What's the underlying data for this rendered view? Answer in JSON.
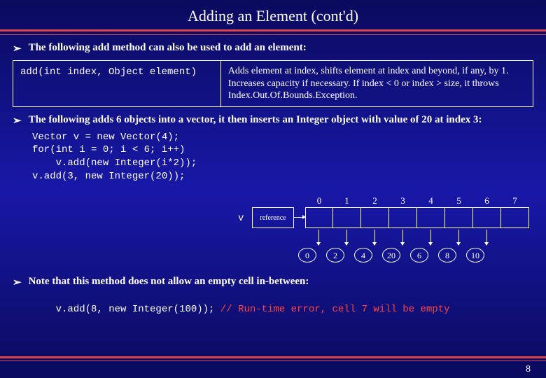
{
  "title": "Adding an Element (cont'd)",
  "bullet1": "The following add method can also be used to add an element:",
  "method": {
    "signature": "add(int index, Object element)",
    "description": "Adds element at index, shifts element at index and beyond, if any, by 1. Increases capacity if necessary. If index < 0 or index > size, it throws Index.Out.Of.Bounds.Exception."
  },
  "bullet2": "The following adds 6 objects into a vector, it then inserts an Integer object with value of 20 at index 3:",
  "code1": "Vector v = new Vector(4);\nfor(int i = 0; i < 6; i++)\n    v.add(new Integer(i*2));\nv.add(3, new Integer(20));",
  "diagram": {
    "var": "v",
    "ref": "reference",
    "indices": [
      "0",
      "1",
      "2",
      "3",
      "4",
      "5",
      "6",
      "7"
    ],
    "objects": [
      "0",
      "2",
      "4",
      "20",
      "6",
      "8",
      "10"
    ]
  },
  "bullet3": "Note that this method does not allow an empty cell in-between:",
  "code_err": {
    "code": "v.add(8, new Integer(100)); ",
    "comment": "// Run-time error, cell 7 will be empty"
  },
  "page": "8"
}
